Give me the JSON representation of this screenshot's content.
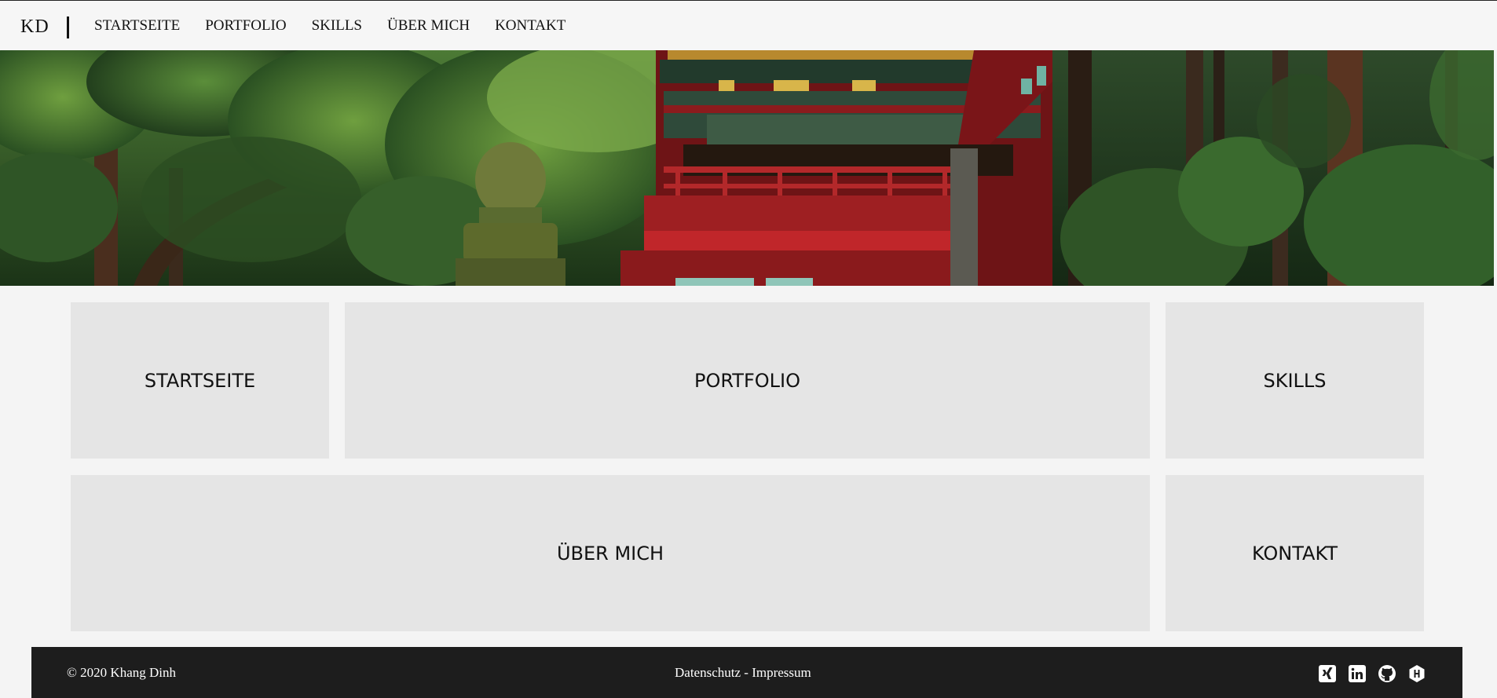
{
  "brand": "KD",
  "nav": {
    "links": [
      "STARTSEITE",
      "PORTFOLIO",
      "SKILLS",
      "ÜBER MICH",
      "KONTAKT"
    ]
  },
  "tiles": {
    "startseite": "STARTSEITE",
    "portfolio": "PORTFOLIO",
    "skills": "SKILLS",
    "ueber_mich": "ÜBER MICH",
    "kontakt": "KONTAKT"
  },
  "footer": {
    "copyright": "© 2020 Khang Dinh",
    "datenschutz": "Datenschutz",
    "separator": " - ",
    "impressum": "Impressum",
    "icons": [
      "xing-icon",
      "linkedin-icon",
      "github-icon",
      "hackerrank-icon"
    ]
  },
  "colors": {
    "page_bg": "#f4f4f4",
    "tile_bg": "#e5e5e5",
    "footer_bg": "#1d1d1d",
    "temple_red": "#9c1b1f"
  }
}
